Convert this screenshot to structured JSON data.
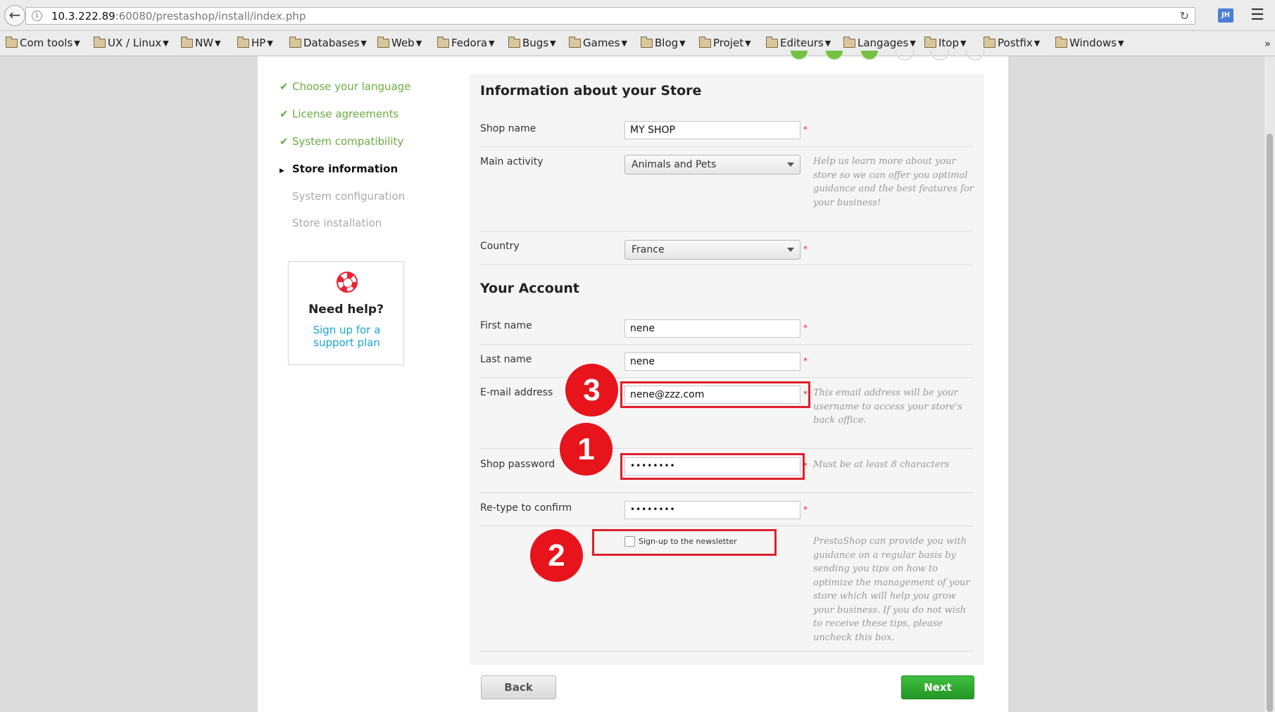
{
  "browser": {
    "url_host": "10.3.222.89",
    "url_rest": ":60080/prestashop/install/index.php",
    "extension_label": "JH",
    "bookmarks": [
      {
        "label": "Com tools"
      },
      {
        "label": "UX / Linux"
      },
      {
        "label": "NW"
      },
      {
        "label": "HP"
      },
      {
        "label": "Databases"
      },
      {
        "label": "Web"
      },
      {
        "label": "Fedora"
      },
      {
        "label": "Bugs"
      },
      {
        "label": "Games"
      },
      {
        "label": "Blog"
      },
      {
        "label": "Projet"
      },
      {
        "label": "Editeurs"
      },
      {
        "label": "Langages"
      },
      {
        "label": "Itop"
      },
      {
        "label": "Postfix"
      },
      {
        "label": "Windows"
      }
    ],
    "bookmarks_more": "»"
  },
  "steps": [
    {
      "label": "Choose your language",
      "state": "done"
    },
    {
      "label": "License agreements",
      "state": "done"
    },
    {
      "label": "System compatibility",
      "state": "done"
    },
    {
      "label": "Store information",
      "state": "current"
    },
    {
      "label": "System configuration",
      "state": "todo"
    },
    {
      "label": "Store installation",
      "state": "todo"
    }
  ],
  "help": {
    "title": "Need help?",
    "link": "Sign up for a support plan"
  },
  "store_section": {
    "title": "Information about your Store",
    "shop_name_label": "Shop name",
    "shop_name_value": "MY SHOP",
    "main_activity_label": "Main activity",
    "main_activity_value": "Animals and Pets",
    "main_activity_hint": "Help us learn more about your store so we can offer you optimal guidance and the best features for your business!",
    "country_label": "Country",
    "country_value": "France"
  },
  "account_section": {
    "title": "Your Account",
    "first_name_label": "First name",
    "first_name_value": "nene",
    "last_name_label": "Last name",
    "last_name_value": "nene",
    "email_label": "E-mail address",
    "email_value": "nene@zzz.com",
    "email_hint": "This email address will be your username to access your store's back office.",
    "password_label": "Shop password",
    "password_value": "••••••••",
    "password_hint": "Must be at least 8 characters",
    "retype_label": "Re-type to confirm",
    "retype_value": "••••••••",
    "newsletter_label": "Sign-up to the newsletter",
    "newsletter_checked": false,
    "newsletter_hint": "PrestaShop can provide you with guidance on a regular basis by sending you tips on how to optimize the management of your store which will help you grow your business. If you do not wish to receive these tips, please uncheck this box."
  },
  "annotations": {
    "badge_1": "1",
    "badge_2": "2",
    "badge_3": "3"
  },
  "buttons": {
    "back": "Back",
    "next": "Next"
  },
  "required_marker": "*"
}
